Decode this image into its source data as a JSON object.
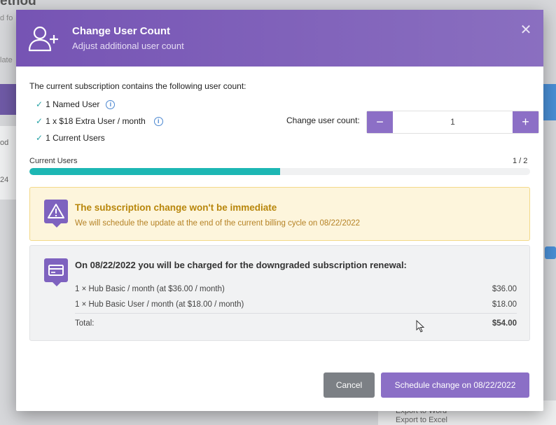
{
  "background": {
    "title_fragment": "ethod",
    "sub_fragment": "d fo",
    "update_fragment": "late",
    "cell1": "od",
    "cell2": "24",
    "export_word": "Export to Word",
    "export_excel": "Export to Excel"
  },
  "modal": {
    "title": "Change User Count",
    "subtitle": "Adjust additional user count",
    "close_glyph": "✕",
    "intro": "The current subscription contains the following user count:",
    "items": [
      {
        "label": "1 Named User",
        "has_info": true
      },
      {
        "label": "1 x $18 Extra User / month",
        "has_info": true
      },
      {
        "label": "1 Current Users",
        "has_info": false
      }
    ],
    "check_glyph": "✓",
    "info_glyph": "i",
    "change_label": "Change user count:",
    "stepper": {
      "minus": "−",
      "plus": "+",
      "value": "1"
    },
    "current_users_label": "Current Users",
    "current_users_count": "1 / 2",
    "progress_fraction": 0.5,
    "warning": {
      "title": "The subscription change won't be immediate",
      "text": "We will schedule the update at the end of the current billing cycle on 08/22/2022"
    },
    "charge": {
      "title": "On 08/22/2022 you will be charged for the downgraded subscription renewal:",
      "lines": [
        {
          "desc": "1 × Hub Basic / month (at $36.00 / month)",
          "amount": "$36.00"
        },
        {
          "desc": "1 × Hub Basic User / month (at $18.00 / month)",
          "amount": "$18.00"
        }
      ],
      "total_label": "Total:",
      "total_amount": "$54.00"
    },
    "buttons": {
      "cancel": "Cancel",
      "schedule": "Schedule change on 08/22/2022"
    }
  },
  "colors": {
    "header_purple": "#7654b4",
    "accent_purple": "#8b6fc6",
    "progress_teal": "#1db7b4",
    "warning_text": "#b8860b"
  }
}
